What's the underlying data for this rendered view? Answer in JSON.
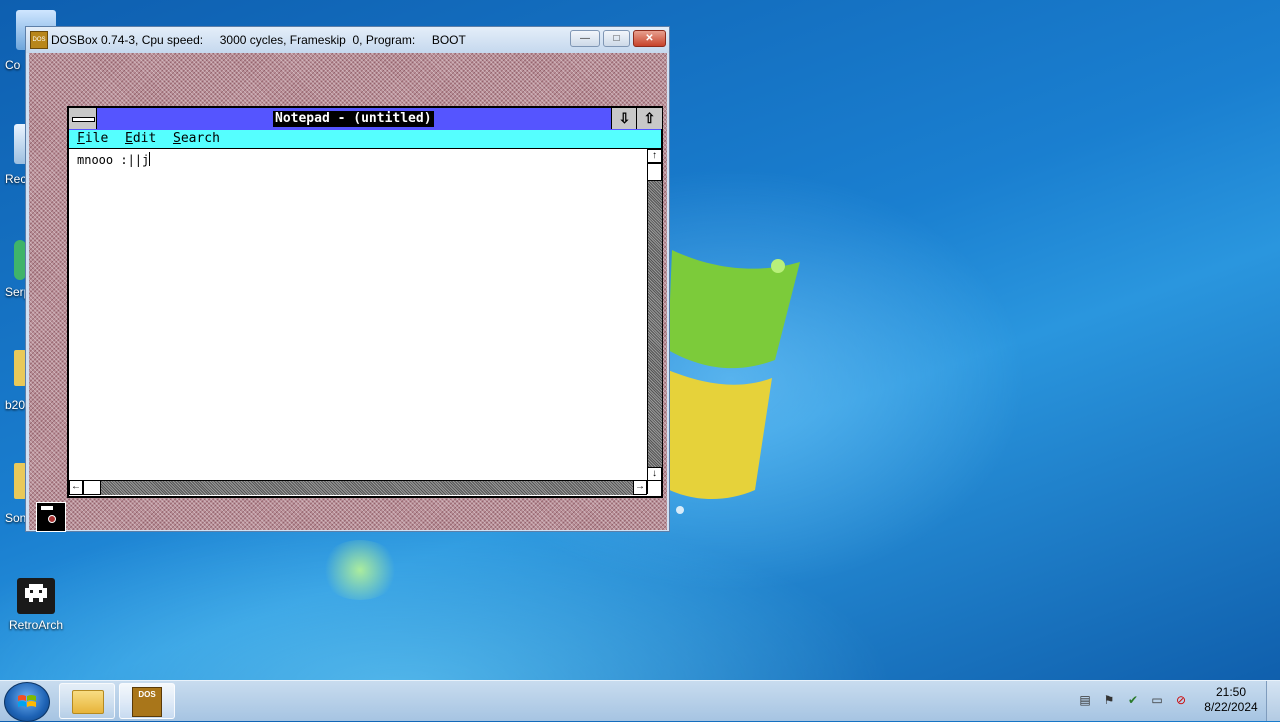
{
  "desktop": {
    "icons": [
      {
        "label": "Co",
        "name": "computer"
      },
      {
        "label": "Rec",
        "name": "recycle-bin"
      },
      {
        "label": "Serp",
        "name": "serp"
      },
      {
        "label": "b20",
        "name": "b20-folder"
      },
      {
        "label": "Son",
        "name": "son-folder"
      },
      {
        "label": "RetroArch",
        "name": "retroarch"
      }
    ]
  },
  "dosbox": {
    "title": "DOSBox 0.74-3, Cpu speed:     3000 cycles, Frameskip  0, Program:     BOOT",
    "app_icon_text": "DOS",
    "minimize_glyph": "—",
    "maximize_glyph": "□",
    "close_glyph": "✕"
  },
  "notepad": {
    "title": "Notepad - (untitled)",
    "menus": [
      {
        "accel": "F",
        "rest": "ile"
      },
      {
        "accel": "E",
        "rest": "dit"
      },
      {
        "accel": "S",
        "rest": "earch"
      }
    ],
    "content": "mnooo :||j",
    "min_glyph": "⇩",
    "max_glyph": "⇧",
    "scroll_up": "↑",
    "scroll_down": "↓",
    "scroll_left": "←",
    "scroll_right": "→"
  },
  "taskbar": {
    "buttons": [
      {
        "name": "windows-explorer"
      },
      {
        "name": "dosbox",
        "icon_text": "DOS"
      }
    ],
    "tray_icons": [
      "notes-icon",
      "flag-icon",
      "network-icon",
      "display-icon",
      "volume-muted-icon"
    ],
    "clock": {
      "time": "21:50",
      "date": "8/22/2024"
    }
  }
}
